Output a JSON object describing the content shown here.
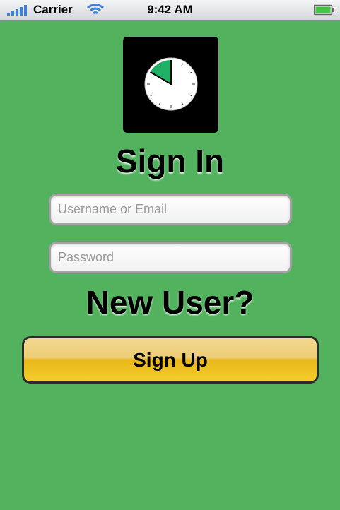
{
  "status_bar": {
    "carrier": "Carrier",
    "time": "9:42 AM",
    "signal_icon": "signal-bars-icon",
    "wifi_icon": "wifi-icon",
    "battery_icon": "battery-icon"
  },
  "app_icon": {
    "icon": "stopwatch-icon",
    "background": "#000000",
    "accent": "#1fb266"
  },
  "sign_in": {
    "title": "Sign In",
    "username_placeholder": "Username or Email",
    "username_value": "",
    "password_placeholder": "Password",
    "password_value": ""
  },
  "new_user": {
    "title": "New User?",
    "signup_label": "Sign Up"
  },
  "colors": {
    "background": "#52b25e",
    "button": "#f0c524"
  }
}
